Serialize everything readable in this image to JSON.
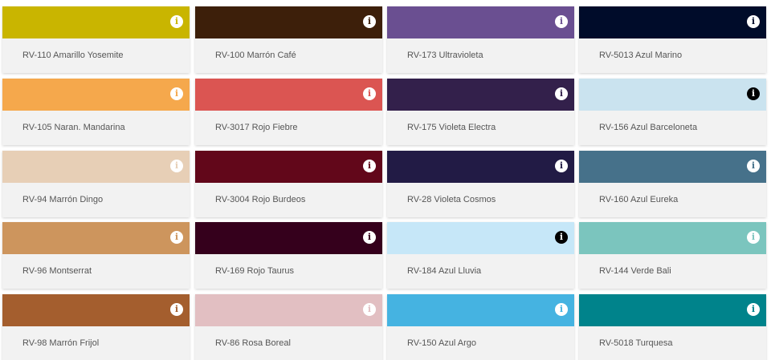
{
  "swatches": [
    {
      "code_name": "RV-110 Amarillo Yosemite",
      "color": "#c9b500",
      "icon": "info-icon",
      "icon_style": "light"
    },
    {
      "code_name": "RV-100 Marrón Café",
      "color": "#3d1f0a",
      "icon": "info-icon",
      "icon_style": "light"
    },
    {
      "code_name": "RV-173 Ultravioleta",
      "color": "#6a4f91",
      "icon": "info-icon",
      "icon_style": "light"
    },
    {
      "code_name": "RV-5013 Azul Marino",
      "color": "#000c2a",
      "icon": "info-icon",
      "icon_style": "light"
    },
    {
      "code_name": "RV-105 Naran. Mandarina",
      "color": "#f5a84c",
      "icon": "info-icon",
      "icon_style": "light"
    },
    {
      "code_name": "RV-3017 Rojo Fiebre",
      "color": "#db5552",
      "icon": "info-icon",
      "icon_style": "light"
    },
    {
      "code_name": "RV-175 Violeta Electra",
      "color": "#33204b",
      "icon": "info-icon",
      "icon_style": "light"
    },
    {
      "code_name": "RV-156 Azul Barceloneta",
      "color": "#cae3ef",
      "icon": "info-icon",
      "icon_style": "dark"
    },
    {
      "code_name": "RV-94 Marrón Dingo",
      "color": "#e7cfb6",
      "icon": "info-icon",
      "icon_style": "light"
    },
    {
      "code_name": "RV-3004 Rojo Burdeos",
      "color": "#62071a",
      "icon": "info-icon",
      "icon_style": "light"
    },
    {
      "code_name": "RV-28 Violeta Cosmos",
      "color": "#221b45",
      "icon": "info-icon",
      "icon_style": "light"
    },
    {
      "code_name": "RV-160 Azul Eureka",
      "color": "#46718a",
      "icon": "info-icon",
      "icon_style": "light"
    },
    {
      "code_name": "RV-96 Montserrat",
      "color": "#cd955d",
      "icon": "info-icon",
      "icon_style": "light"
    },
    {
      "code_name": "RV-169 Rojo Taurus",
      "color": "#35001c",
      "icon": "info-icon",
      "icon_style": "light"
    },
    {
      "code_name": "RV-184 Azul Lluvia",
      "color": "#c6e7f8",
      "icon": "info-icon",
      "icon_style": "dark"
    },
    {
      "code_name": "RV-144 Verde Bali",
      "color": "#7bc5be",
      "icon": "info-icon",
      "icon_style": "light"
    },
    {
      "code_name": "RV-98 Marrón Frijol",
      "color": "#a45e2e",
      "icon": "info-icon",
      "icon_style": "light"
    },
    {
      "code_name": "RV-86 Rosa Boreal",
      "color": "#e2bfc2",
      "icon": "info-icon",
      "icon_style": "light"
    },
    {
      "code_name": "RV-150 Azul Argo",
      "color": "#45b3e1",
      "icon": "info-icon",
      "icon_style": "light"
    },
    {
      "code_name": "RV-5018 Turquesa",
      "color": "#00838b",
      "icon": "info-icon",
      "icon_style": "light"
    }
  ]
}
